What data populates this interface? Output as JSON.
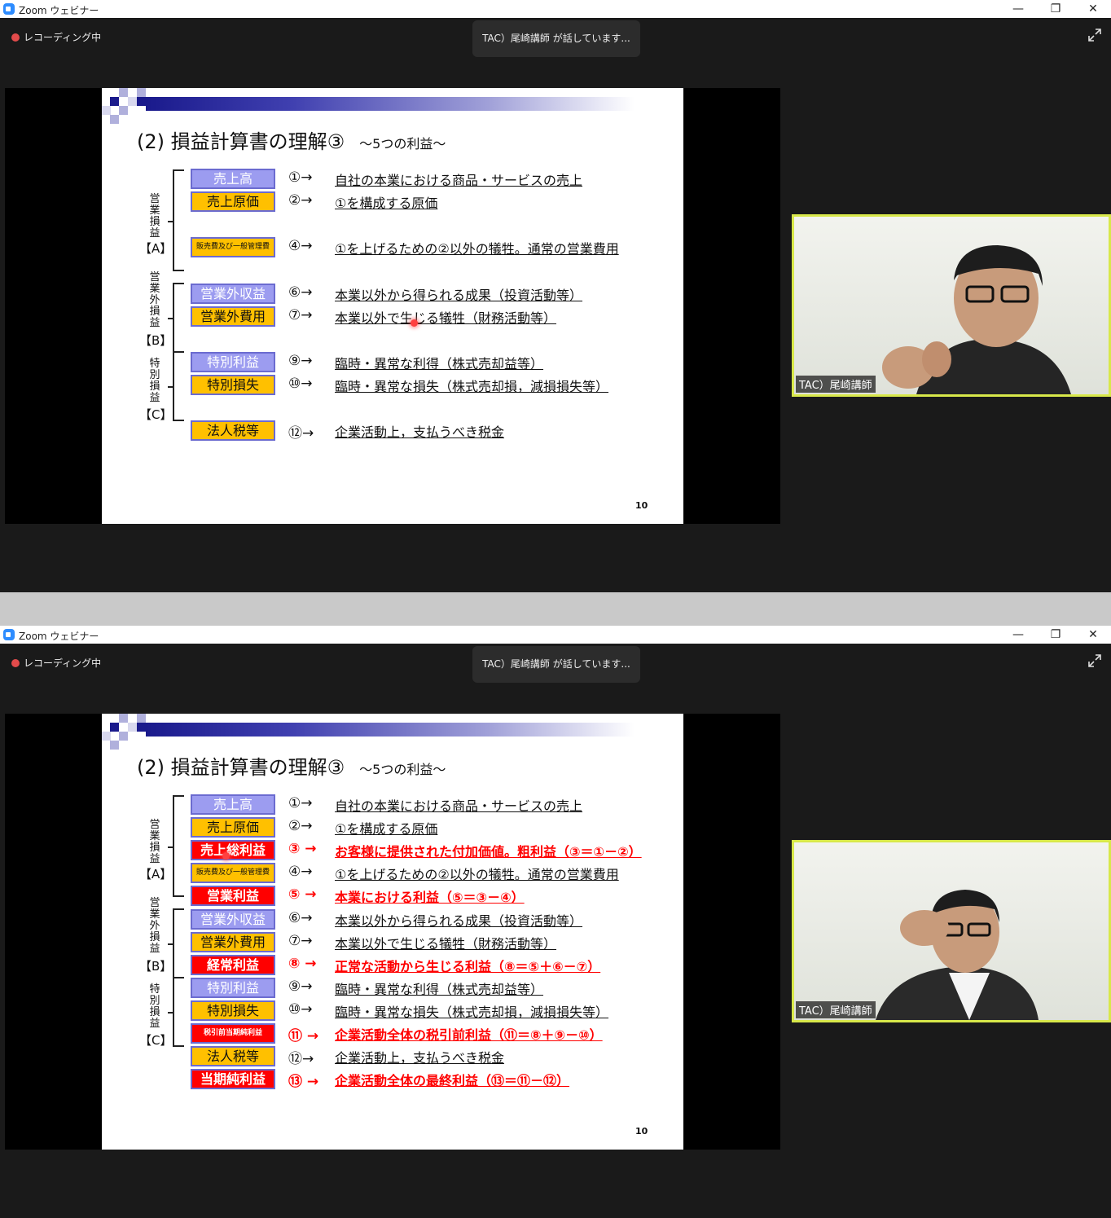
{
  "app_title": "Zoom ウェビナー",
  "window_buttons": {
    "minimize": "—",
    "restore": "❐",
    "close": "✕"
  },
  "recording_label": "レコーディング中",
  "speaker_banner": "TAC）尾崎講師 が話しています...",
  "participant_name": "TAC）尾崎講師",
  "slide": {
    "title": "(2) 損益計算書の理解③",
    "subtitle": "～5つの利益～",
    "page_number": "10",
    "groups": [
      {
        "vertical": [
          "営",
          "業",
          "損",
          "益"
        ],
        "bracket": "【A】"
      },
      {
        "vertical": [
          "営",
          "業",
          "外",
          "損",
          "益"
        ],
        "bracket": "【B】"
      },
      {
        "vertical": [
          "特",
          "別",
          "損",
          "益"
        ],
        "bracket": "【C】"
      }
    ],
    "rows": [
      {
        "box": "売上高",
        "num": "①→",
        "desc": "自社の本業における商品・サービスの売上"
      },
      {
        "box": "売上原価",
        "num": "②→",
        "desc": "①を構成する原価"
      },
      {
        "box": "売上総利益",
        "num": "③ →",
        "desc": "お客様に提供された付加価値。粗利益（③＝①－②）"
      },
      {
        "box": "販売費及び一般管理費",
        "num": "④→",
        "desc": "①を上げるための②以外の犠牲。通常の営業費用"
      },
      {
        "box": "営業利益",
        "num": "⑤ →",
        "desc": "本業における利益（⑤＝③－④）"
      },
      {
        "box": "営業外収益",
        "num": "⑥→",
        "desc": "本業以外から得られる成果（投資活動等）"
      },
      {
        "box": "営業外費用",
        "num": "⑦→",
        "desc": "本業以外で生じる犠牲（財務活動等）"
      },
      {
        "box": "経常利益",
        "num": "⑧ →",
        "desc": "正常な活動から生じる利益（⑧＝⑤＋⑥－⑦）"
      },
      {
        "box": "特別利益",
        "num": "⑨→",
        "desc": "臨時・異常な利得（株式売却益等）"
      },
      {
        "box": "特別損失",
        "num": "⑩→",
        "desc": "臨時・異常な損失（株式売却損，減損損失等）"
      },
      {
        "box": "税引前当期純利益",
        "num": "⑪ →",
        "desc": "企業活動全体の税引前利益（⑪＝⑧＋⑨－⑩）"
      },
      {
        "box": "法人税等",
        "num": "⑫→",
        "desc": "企業活動上，支払うべき税金"
      },
      {
        "box": "当期純利益",
        "num": "⑬ →",
        "desc": "企業活動全体の最終利益（⑬＝⑪－⑫）"
      }
    ]
  }
}
